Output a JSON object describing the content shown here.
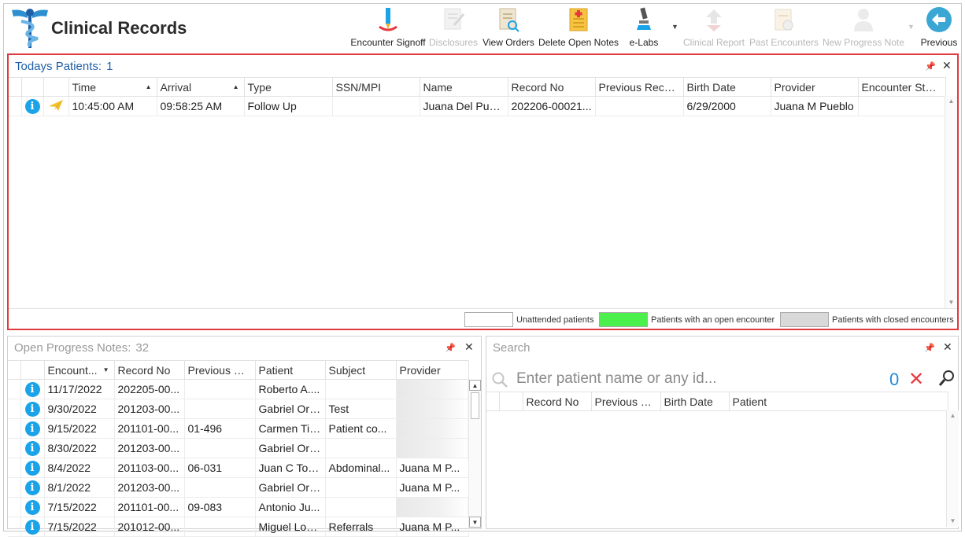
{
  "app": {
    "title": "Clinical Records"
  },
  "toolbar": {
    "encounter_signoff": "Encounter Signoff",
    "disclosures": "Disclosures",
    "view_orders": "View Orders",
    "delete_open_notes": "Delete Open Notes",
    "e_labs": "e-Labs",
    "clinical_report": "Clinical Report",
    "past_encounters": "Past Encounters",
    "new_progress_note": "New Progress Note",
    "previous": "Previous"
  },
  "todays_patients": {
    "title": "Todays Patients:",
    "count": "1",
    "columns": [
      "Time",
      "Arrival",
      "Type",
      "SSN/MPI",
      "Name",
      "Record No",
      "Previous Recor...",
      "Birth Date",
      "Provider",
      "Encounter Stat..."
    ],
    "rows": [
      {
        "time": "10:45:00 AM",
        "arrival": "09:58:25 AM",
        "type": "Follow Up",
        "ssn": "",
        "name": "Juana Del Pue...",
        "record_no": "202206-00021...",
        "previous_record": "",
        "birth_date": "6/29/2000",
        "provider": "Juana M Pueblo",
        "status": ""
      }
    ],
    "legend": {
      "unattended": "Unattended patients",
      "open": "Patients with an open encounter",
      "closed": "Patients with closed encounters"
    }
  },
  "open_progress_notes": {
    "title": "Open Progress Notes:",
    "count": "32",
    "columns": [
      "Encount...",
      "Record No",
      "Previous Re...",
      "Patient",
      "Subject",
      "Provider"
    ],
    "rows": [
      {
        "date": "11/17/2022",
        "record_no": "202205-00...",
        "previous": "",
        "patient": "Roberto A....",
        "subject": "",
        "provider": ""
      },
      {
        "date": "9/30/2022",
        "record_no": "201203-00...",
        "previous": "",
        "patient": "Gabriel Ort...",
        "subject": "Test",
        "provider": ""
      },
      {
        "date": "9/15/2022",
        "record_no": "201101-00...",
        "previous": "01-496",
        "patient": "Carmen Tir...",
        "subject": "Patient co...",
        "provider": ""
      },
      {
        "date": "8/30/2022",
        "record_no": "201203-00...",
        "previous": "",
        "patient": "Gabriel Ort...",
        "subject": "",
        "provider": ""
      },
      {
        "date": "8/4/2022",
        "record_no": "201103-00...",
        "previous": "06-031",
        "patient": "Juan C Torr...",
        "subject": "Abdominal...",
        "provider": "Juana M P..."
      },
      {
        "date": "8/1/2022",
        "record_no": "201203-00...",
        "previous": "",
        "patient": "Gabriel Ort...",
        "subject": "",
        "provider": "Juana M P..."
      },
      {
        "date": "7/15/2022",
        "record_no": "201101-00...",
        "previous": "09-083",
        "patient": "Antonio Ju...",
        "subject": "",
        "provider": ""
      },
      {
        "date": "7/15/2022",
        "record_no": "201012-00...",
        "previous": "",
        "patient": "Miguel Lop...",
        "subject": "Referrals",
        "provider": "Juana M P..."
      }
    ]
  },
  "search": {
    "title": "Search",
    "placeholder": "Enter patient name or any id...",
    "count": "0",
    "columns": [
      "Record No",
      "Previous R...",
      "Birth Date",
      "Patient"
    ]
  },
  "colors": {
    "accent": "#1f5fa6",
    "highlight_border": "#e0393e",
    "open_encounter": "#4cf04c",
    "closed_encounter": "#d9d9d9",
    "info": "#1aa3e8"
  }
}
